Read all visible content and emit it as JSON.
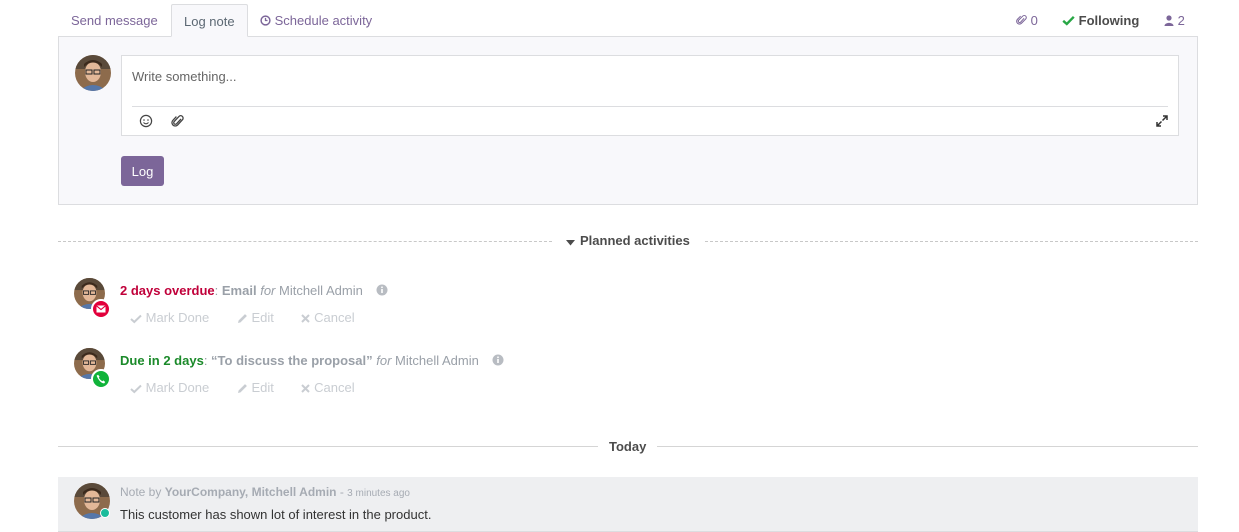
{
  "tabs": {
    "send_message": "Send message",
    "log_note": "Log note",
    "schedule_activity": "Schedule activity"
  },
  "toolbar": {
    "attachments_count": "0",
    "following_label": "Following",
    "followers_count": "2"
  },
  "composer": {
    "placeholder": "Write something...",
    "log_button": "Log",
    "icons": [
      "emoji-icon",
      "paperclip-icon",
      "expand-icon"
    ]
  },
  "planned": {
    "title": "Planned activities",
    "activities": [
      {
        "status": "2 days overdue",
        "type": "Email",
        "for_label": "for",
        "assignee": "Mitchell Admin",
        "badge_color": "#e2003b",
        "badge_icon": "envelope-icon",
        "actions": [
          "Mark Done",
          "Edit",
          "Cancel"
        ]
      },
      {
        "status": "Due in 2 days",
        "type": "“To discuss the proposal”",
        "for_label": "for",
        "assignee": "Mitchell Admin",
        "badge_color": "#10b33a",
        "badge_icon": "phone-icon",
        "actions": [
          "Mark Done",
          "Edit",
          "Cancel"
        ]
      }
    ]
  },
  "today_label": "Today",
  "message": {
    "prefix": "Note by",
    "author": "YourCompany, Mitchell Admin",
    "dash": " - ",
    "time_ago": "3 minutes ago",
    "body": "This customer has shown lot of interest in the product."
  },
  "colors": {
    "accent": "#7c6699",
    "overdue": "#c0003a",
    "due": "#1b8a2a",
    "following_check": "#28a745"
  }
}
